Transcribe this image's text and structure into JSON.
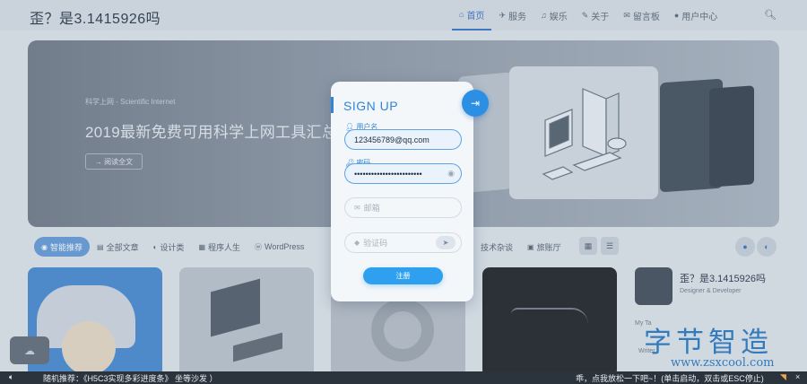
{
  "header": {
    "logo": "歪？是3.1415926吗",
    "nav": [
      {
        "icon": "home-icon",
        "glyph": "⌂",
        "label": "首页"
      },
      {
        "icon": "bird-icon",
        "glyph": "✈",
        "label": "服务"
      },
      {
        "icon": "gamepad-icon",
        "glyph": "♫",
        "label": "娱乐"
      },
      {
        "icon": "doc-icon",
        "glyph": "✎",
        "label": "关于"
      },
      {
        "icon": "chat-icon",
        "glyph": "✉",
        "label": "留言板"
      },
      {
        "icon": "user-icon",
        "glyph": "●",
        "label": "用户中心"
      }
    ],
    "active_nav": 0
  },
  "banner": {
    "subtitle": "科学上网 - Scientific Internet",
    "title": "2019最新免费可用科学上网工具汇总",
    "button": "阅读全文"
  },
  "categories": [
    {
      "label": "智能推荐",
      "glyph": "◉",
      "icon": "bulb-icon"
    },
    {
      "label": "全部文章",
      "glyph": "▤",
      "icon": "folder-icon"
    },
    {
      "label": "设计类",
      "glyph": "◐",
      "icon": "palette-icon"
    },
    {
      "label": "程序人生",
      "glyph": "▦",
      "icon": "code-icon"
    },
    {
      "label": "WordPress",
      "glyph": "ⓦ",
      "icon": "wordpress-icon"
    }
  ],
  "categories_right": [
    {
      "label": "技术杂谈",
      "glyph": "",
      "icon": "tech-icon"
    },
    {
      "label": "旅账厅",
      "glyph": "▣",
      "icon": "ledger-icon"
    }
  ],
  "profile": {
    "name": "歪？是3.1415926吗",
    "role": "Designer & Developer",
    "sub": "My Ta",
    "tag": "Writer"
  },
  "watermark": {
    "text": "字节智造",
    "url": "www.zsxcool.com"
  },
  "ticker": {
    "left": "随机推荐：《H5C3实现多彩进度条》 坐等沙发 ）",
    "right": "乖，点我放松一下吧~！(单击启动，双击或ESC停止)"
  },
  "modal": {
    "title": "SIGN UP",
    "username_label": "用户名",
    "username_value": "123456789@qq.com",
    "password_label": "密码",
    "password_value": "••••••••••••••••••••••••",
    "email_placeholder": "邮箱",
    "captcha_placeholder": "验证码",
    "submit": "注册"
  },
  "colors": {
    "accent": "#2f86d8",
    "submit": "#2ea0ef",
    "ticker_bg": "#2b333d"
  }
}
